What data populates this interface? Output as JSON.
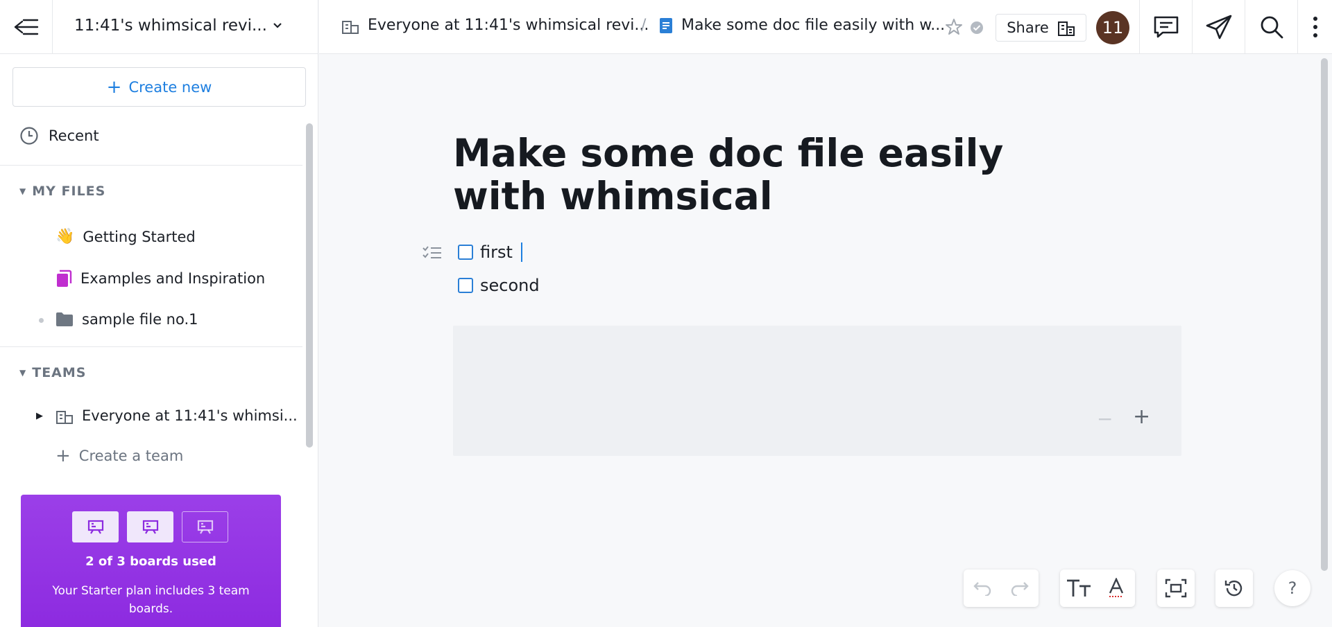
{
  "sidebar": {
    "workspace_name": "11:41's whimsical revi...",
    "create_new": "Create new",
    "recent": "Recent",
    "my_files_header": "MY FILES",
    "my_files": [
      {
        "label": "Getting Started",
        "icon": "waving-hand-icon"
      },
      {
        "label": "Examples and Inspiration",
        "icon": "book-icon"
      },
      {
        "label": "sample file no.1",
        "icon": "folder-icon"
      }
    ],
    "teams_header": "TEAMS",
    "team_item": "Everyone at 11:41's whimsi...",
    "create_team": "Create a team",
    "promo": {
      "title": "2 of 3 boards used",
      "text": "Your Starter plan includes 3 team boards.",
      "boards_used": 2,
      "boards_total": 3
    }
  },
  "topbar": {
    "breadcrumb_team": "Everyone at 11:41's whimsical revi...",
    "breadcrumb_sep": "/",
    "breadcrumb_doc": "Make some doc file easily with w...",
    "share_label": "Share",
    "avatar_initials": "11"
  },
  "document": {
    "title": "Make some doc file easily with whimsical",
    "checklist": [
      {
        "text": "first",
        "checked": false
      },
      {
        "text": "second",
        "checked": false
      }
    ],
    "zoom_minus": "−",
    "zoom_plus": "+"
  },
  "help_label": "?",
  "colors": {
    "accent": "#1e7fe0",
    "promo": "#8d2be0",
    "avatar": "#5a3424",
    "examples_icon": "#c02ecf"
  }
}
